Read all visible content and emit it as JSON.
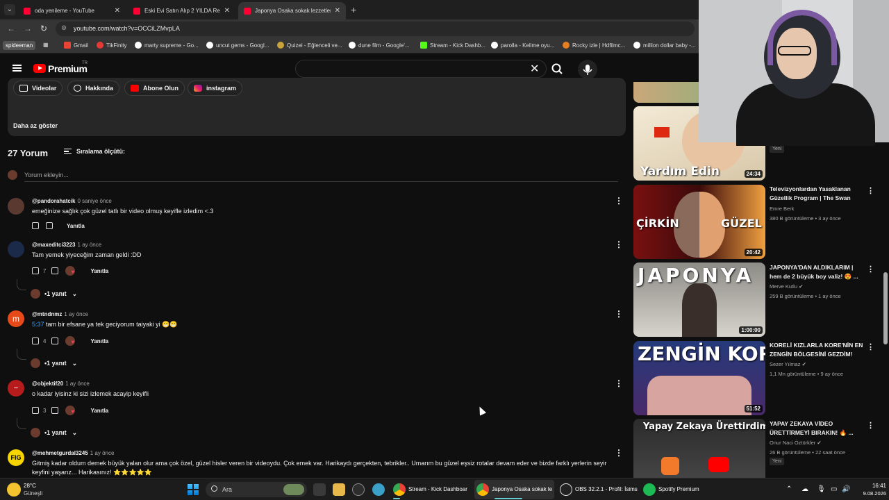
{
  "browser": {
    "tabs": [
      {
        "label": "oda yenileme - YouTube"
      },
      {
        "label": "Eski Evi Satın Alıp 2 YILDA Resto"
      },
      {
        "label": "Japonya Osaka sokak lezzetleri"
      }
    ],
    "url": "youtube.com/watch?v=OCCiLZMvpLA",
    "bookmarks": {
      "profile": "spideeman",
      "items": [
        "Gmail",
        "TikFinity",
        "marty supreme - Go...",
        "uncut gems - Googl...",
        "Quizei - Eğlenceli ve...",
        "dune film - Google'...",
        "Stream - Kick Dashb...",
        "parolla - Kelime oyu...",
        "Rocky izle | Hdfilmc...",
        "million dollar baby -..."
      ]
    }
  },
  "header": {
    "brand": "Premium",
    "region": "TR"
  },
  "channel_links": {
    "videos": "Videolar",
    "about": "Hakkında",
    "subscribe": "Abone Olun",
    "instagram": "instagram",
    "show_less": "Daha az göster"
  },
  "comments": {
    "count": "27 Yorum",
    "sort_label": "Sıralama ölçütü:",
    "add_placeholder": "Yorum ekleyin...",
    "reply_label": "Yanıtla",
    "items": [
      {
        "author": "@pandorahatcik",
        "time": "0 saniye önce",
        "text": "emeğinize sağlık çok güzel tatlı bir video olmuş keyifle izledim <.3",
        "likes": "",
        "replies": ""
      },
      {
        "author": "@maxeditci3223",
        "time": "1 ay önce",
        "text": "Tam yemek yiyeceğim zaman geldi :DD",
        "likes": "7",
        "replies": "1 yanıt"
      },
      {
        "author": "@mtndnmz",
        "time": "1 ay önce",
        "timestamp": "5:37",
        "text": " tam bir efsane ya tek geciyorum taiyaki yi 😁😁",
        "likes": "4",
        "replies": "1 yanıt"
      },
      {
        "author": "@objektif20",
        "time": "1 ay önce",
        "text": "o kadar iyisinz ki sizi izlemek acayip keyifli",
        "likes": "3",
        "replies": "1 yanıt"
      },
      {
        "author": "@mehmetgurdal3245",
        "time": "1 ay önce",
        "text": "Gitmiş kadar oldum demek büyük yalan olur ama çok özel, güzel hisler veren bir videoydu. Çok emek var. Harikaydı gerçekten, tebrikler.. Umarım bu güzel eşsiz rotalar devam eder ve bizde farklı yerlerin seyir",
        "text2": "keyfini yaşarız...    Harikasınız! ⭐⭐⭐⭐⭐"
      }
    ]
  },
  "sidebar": {
    "items": [
      {
        "thumb_text": "Yardım Edin",
        "duration": "24:34",
        "badge": "Yeni"
      },
      {
        "title": "Televizyonlardan Yasaklanan Güzellik Program | The Swan",
        "channel": "Emre Berk",
        "meta": "380 B görüntüleme • 3 ay önce",
        "duration": "20:42",
        "thumb_left": "ÇİRKİN",
        "thumb_right": "GÜZEL"
      },
      {
        "title": "JAPONYA'DAN ALDIKLARIM | hem de 2 büyük boy valiz! 😍 ...",
        "channel": "Merve Kutlu",
        "meta": "259 B görüntüleme • 1 ay önce",
        "duration": "1:00:00",
        "thumb_text": "JAPONYA"
      },
      {
        "title": "KORELİ KIZLARLA KORE'NİN EN ZENGİN BÖLGESİNİ GEZDİM!",
        "channel": "Sezer Yılmaz",
        "meta": "1,1 Mn görüntüleme • 9 ay önce",
        "duration": "51:52",
        "thumb_text": "ZENGİN KORE"
      },
      {
        "title": "YAPAY ZEKAYA VİDEO ÜRETTİRMEYİ BIRAKIN! 🔥 ...",
        "channel": "Onur Naci Öztürkler",
        "meta": "26 B görüntüleme • 22 saat önce",
        "badge": "Yeni",
        "thumb_text": "Yapay Zekaya Ürettirdim..."
      }
    ]
  },
  "taskbar": {
    "temp": "28°C",
    "condition": "Güneşli",
    "search": "Ara",
    "apps": [
      "Stream - Kick Dashboar",
      "Japonya Osaka sokak le",
      "OBS 32.2.1 - Profil: İsims",
      "Spotify Premium"
    ],
    "time": "16:41",
    "date": "9.08.2026"
  },
  "colors": {
    "accent": "#ff0000",
    "link": "#3ea6ff",
    "background": "#0f0f0f"
  }
}
